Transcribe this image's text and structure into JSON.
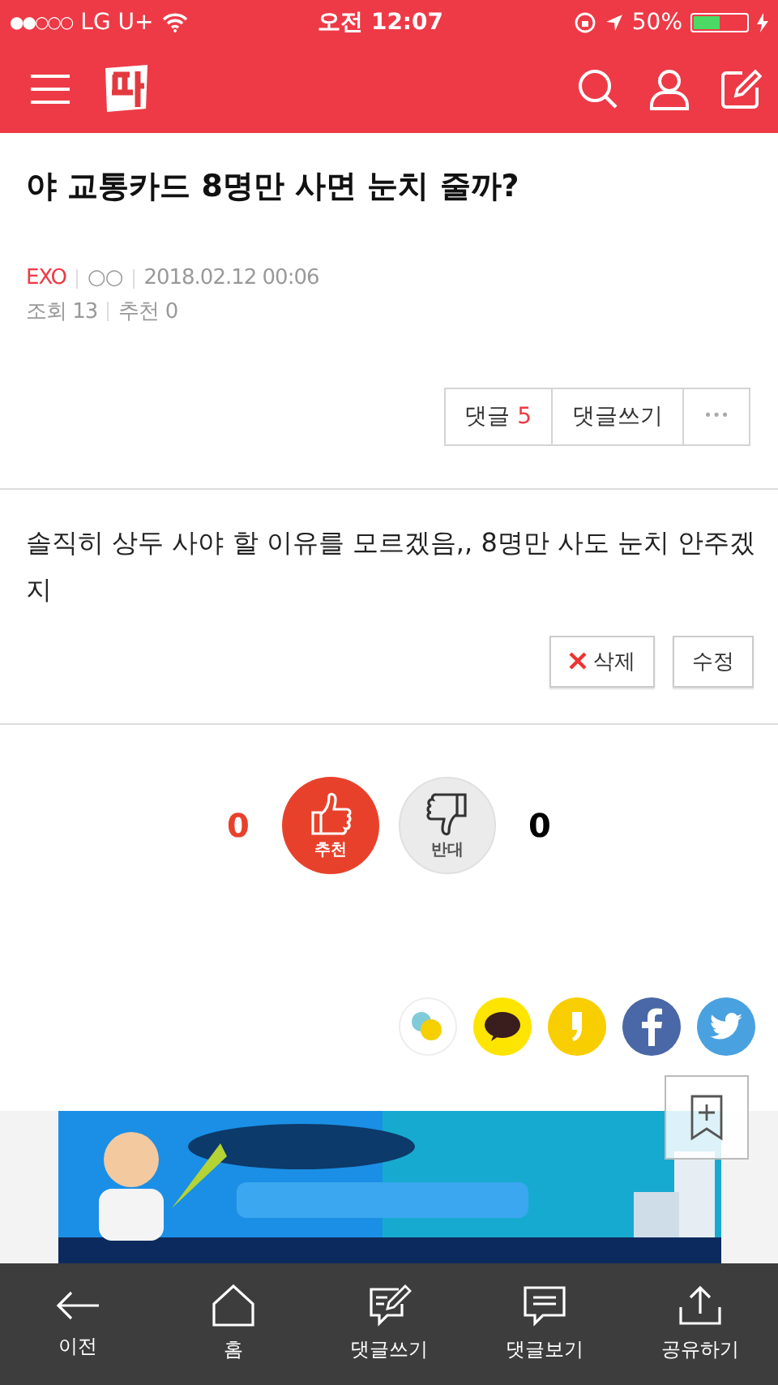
{
  "status_bar": {
    "signal": "●●○○○",
    "carrier": "LG U+",
    "time": "오전 12:07",
    "battery": "50%"
  },
  "post": {
    "title": "야 교통카드 8명만 사면 눈치 줄까?",
    "author": "EXO",
    "author_sub": "○○",
    "date": "2018.02.12 00:06",
    "views_label": "조회",
    "views": "13",
    "recs_label": "추천",
    "recs": "0"
  },
  "post_actions": [
    {
      "kind": "count",
      "label": "댓글",
      "count": "5"
    },
    {
      "kind": "text",
      "label": "댓글쓰기"
    },
    {
      "kind": "more",
      "label": "•••"
    }
  ],
  "comment": {
    "text": "솔직히 상두 사야 할 이유를 모르겠음,, 8명만 사도 눈치 안주겠지",
    "buttons": [
      {
        "kind": "delete",
        "label": "삭제"
      },
      {
        "kind": "edit",
        "label": "수정"
      }
    ]
  },
  "votes": {
    "up_count": "0",
    "up_label": "추천",
    "down_label": "반대",
    "down_count": "0"
  },
  "bottom_nav": [
    {
      "kind": "back",
      "label": "이전"
    },
    {
      "kind": "home",
      "label": "홈"
    },
    {
      "kind": "write",
      "label": "댓글쓰기"
    },
    {
      "kind": "view",
      "label": "댓글보기"
    },
    {
      "kind": "share",
      "label": "공유하기"
    }
  ]
}
